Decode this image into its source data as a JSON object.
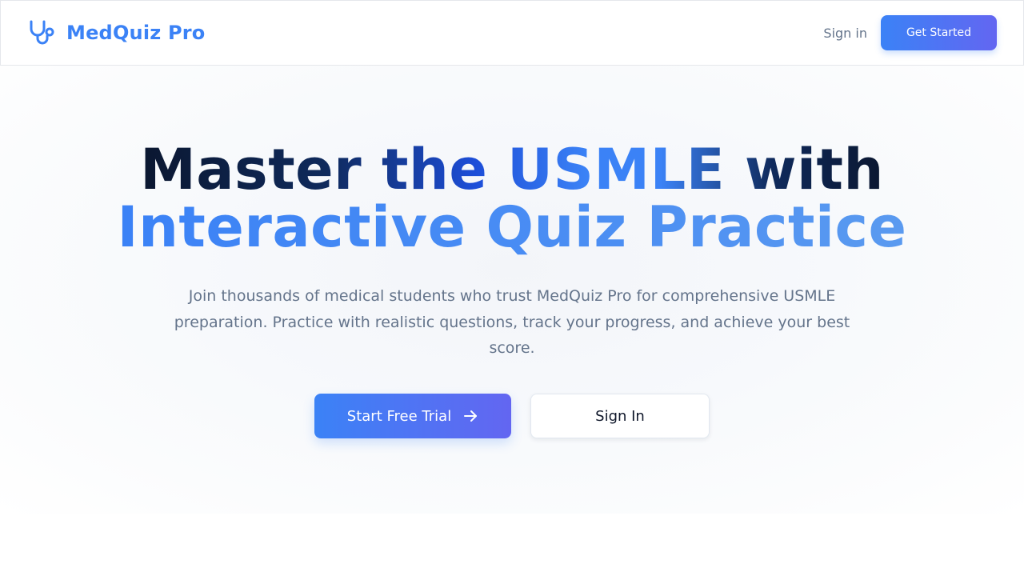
{
  "header": {
    "brand_name": "MedQuiz Pro",
    "brand_icon": "stethoscope-icon",
    "signin_label": "Sign in",
    "get_started_label": "Get Started"
  },
  "hero": {
    "headline_line1": "Master the USMLE with",
    "headline_line2": "Interactive Quiz Practice",
    "subtitle": "Join thousands of medical students who trust MedQuiz Pro for comprehensive USMLE preparation. Practice with realistic questions, track your progress, and achieve your best score.",
    "primary_cta": "Start Free Trial",
    "primary_cta_icon": "arrow-right-icon",
    "secondary_cta": "Sign In"
  },
  "colors": {
    "brand": "#3b82f6",
    "accent_gradient_start": "#3b82f6",
    "accent_gradient_end": "#6366f1",
    "headline_dark": "#0b1730",
    "muted_text": "#64748b"
  }
}
